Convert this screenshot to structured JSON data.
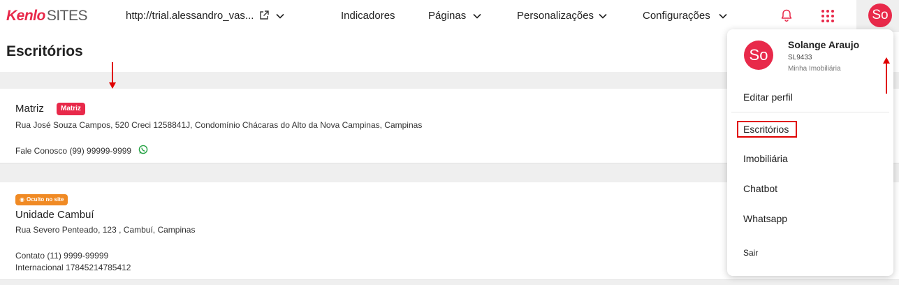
{
  "header": {
    "logo_brand": "Kenlo",
    "logo_suffix": "SITES",
    "site_url": "http://trial.alessandro_vas...",
    "nav": [
      {
        "label": "Indicadores"
      },
      {
        "label": "Páginas"
      },
      {
        "label": "Personalizações"
      },
      {
        "label": "Configurações"
      }
    ],
    "avatar_initials": "So"
  },
  "page": {
    "title": "Escritórios"
  },
  "offices": [
    {
      "name": "Matriz",
      "badge": "Matriz",
      "address": "Rua José Souza Campos, 520 Creci 1258841J, Condomínio Chácaras do Alto da Nova Campinas, Campinas",
      "contacts": [
        "Fale Conosco (99) 99999-9999"
      ],
      "has_whatsapp": true
    },
    {
      "name": "Unidade Cambuí",
      "badge": "Oculto no site",
      "address": "Rua Severo Penteado, 123 , Cambuí, Campinas",
      "contacts": [
        "Contato (11) 9999-99999",
        "Internacional 17845214785412"
      ],
      "has_whatsapp": false
    }
  ],
  "user_menu": {
    "initials": "So",
    "name": "Solange Araujo",
    "code": "SL9433",
    "company": "Minha Imobiliária",
    "items": [
      {
        "label": "Editar perfil"
      },
      {
        "label": "Escritórios",
        "highlighted": true
      },
      {
        "label": "Imobiliária"
      },
      {
        "label": "Chatbot"
      },
      {
        "label": "Whatsapp"
      },
      {
        "label": "Sair"
      }
    ]
  },
  "colors": {
    "brand": "#e8294a",
    "hidden_badge": "#f08a24",
    "annotation": "#e00000",
    "whatsapp": "#25a244"
  },
  "icons": [
    "external-link-icon",
    "chevron-down-icon",
    "bell-icon",
    "apps-grid-icon",
    "whatsapp-icon",
    "eye-icon"
  ]
}
